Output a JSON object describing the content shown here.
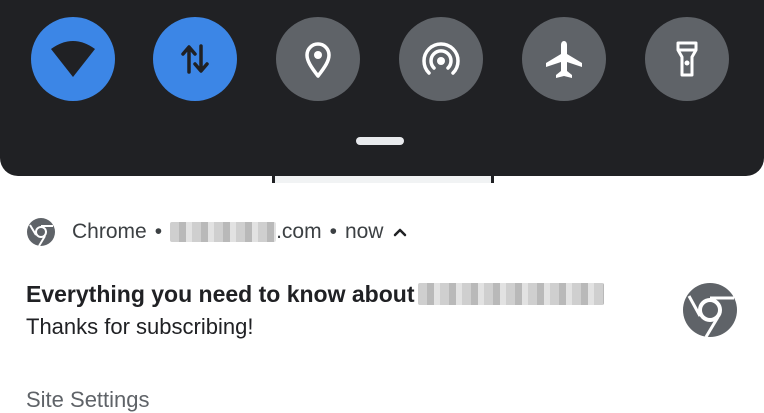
{
  "quick_settings": {
    "tiles": [
      {
        "name": "wifi-tile",
        "icon": "wifi-icon",
        "state": "on"
      },
      {
        "name": "mobile-data-tile",
        "icon": "mobile-data-icon",
        "state": "on"
      },
      {
        "name": "location-tile",
        "icon": "location-pin-icon",
        "state": "off"
      },
      {
        "name": "hotspot-tile",
        "icon": "hotspot-icon",
        "state": "off"
      },
      {
        "name": "airplane-mode-tile",
        "icon": "airplane-icon",
        "state": "off"
      },
      {
        "name": "flashlight-tile",
        "icon": "flashlight-icon",
        "state": "off"
      }
    ],
    "colors": {
      "on": "#3c86e6",
      "off": "#5f6368",
      "panel": "#202124"
    }
  },
  "notification": {
    "app_name": "Chrome",
    "separator": "•",
    "domain_suffix": ".com",
    "time": "now",
    "title": "Everything you need to know about",
    "body": "Thanks for subscribing!",
    "action_label": "Site Settings"
  }
}
